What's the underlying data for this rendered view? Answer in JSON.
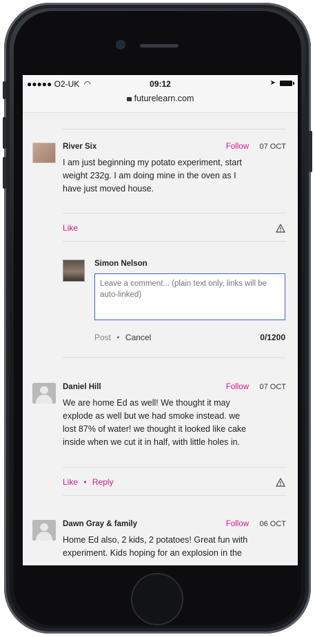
{
  "status_bar": {
    "carrier": "●●●●● O2-UK",
    "time": "09:12",
    "url": "futurelearn.com"
  },
  "comments": [
    {
      "author": "River Six",
      "follow_label": "Follow",
      "date": "07 OCT",
      "lines": [
        "I am just beginning my potato experiment, start",
        "weight 232g. I am doing mine in the oven as I",
        "have just moved house."
      ],
      "like_label": "Like"
    },
    {
      "author": "Daniel Hill",
      "follow_label": "Follow",
      "date": "07 OCT",
      "lines": [
        "We are home Ed as well! We thought it may",
        "explode as well but we had smoke instead. we",
        "lost 87% of water! we thought it looked like cake",
        "inside when we cut it in half, with little holes in."
      ],
      "like_label": "Like",
      "reply_label": "Reply"
    },
    {
      "author": "Dawn Gray & family",
      "follow_label": "Follow",
      "date": "06 OCT",
      "lines": [
        "Home Ed also, 2 kids, 2 potatoes! Great fun with",
        "experiment. Kids hoping for an explosion in the"
      ]
    }
  ],
  "reply_form": {
    "user": "Simon Nelson",
    "placeholder": "Leave a comment... (plain text only, links will be auto-linked)",
    "post_label": "Post",
    "cancel_label": "Cancel",
    "counter": "0/1200"
  }
}
